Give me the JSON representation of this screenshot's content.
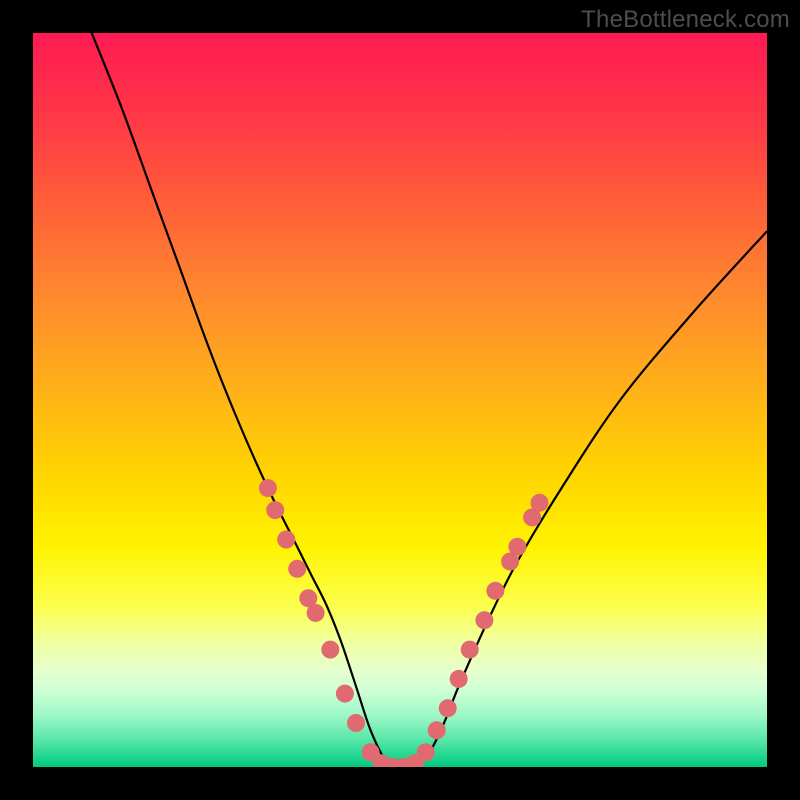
{
  "watermark": "TheBottleneck.com",
  "chart_data": {
    "type": "line",
    "title": "",
    "xlabel": "",
    "ylabel": "",
    "xlim": [
      0,
      100
    ],
    "ylim": [
      0,
      100
    ],
    "grid": false,
    "legend": false,
    "series": [
      {
        "name": "bottleneck-curve",
        "color": "#000000",
        "x": [
          8,
          12,
          16,
          20,
          24,
          28,
          32,
          36,
          38,
          40,
          42,
          44,
          46,
          48,
          50,
          52,
          54,
          56,
          58,
          62,
          66,
          72,
          80,
          90,
          100
        ],
        "y": [
          100,
          90,
          79,
          68,
          57,
          47,
          38,
          30,
          26,
          22,
          17,
          11,
          5,
          1,
          0,
          0.5,
          2,
          6,
          11,
          20,
          28,
          38,
          50,
          62,
          73
        ]
      }
    ],
    "markers": {
      "name": "scatter-dots",
      "color": "#e06a6f",
      "radius_px": 9,
      "points": [
        {
          "x": 32.0,
          "y": 38
        },
        {
          "x": 33.0,
          "y": 35
        },
        {
          "x": 34.5,
          "y": 31
        },
        {
          "x": 36.0,
          "y": 27
        },
        {
          "x": 37.5,
          "y": 23
        },
        {
          "x": 38.5,
          "y": 21
        },
        {
          "x": 40.5,
          "y": 16
        },
        {
          "x": 42.5,
          "y": 10
        },
        {
          "x": 44.0,
          "y": 6
        },
        {
          "x": 46.0,
          "y": 2
        },
        {
          "x": 47.5,
          "y": 0.5
        },
        {
          "x": 49.0,
          "y": 0
        },
        {
          "x": 50.5,
          "y": 0
        },
        {
          "x": 52.0,
          "y": 0.5
        },
        {
          "x": 53.5,
          "y": 2
        },
        {
          "x": 55.0,
          "y": 5
        },
        {
          "x": 56.5,
          "y": 8
        },
        {
          "x": 58.0,
          "y": 12
        },
        {
          "x": 59.5,
          "y": 16
        },
        {
          "x": 61.5,
          "y": 20
        },
        {
          "x": 63.0,
          "y": 24
        },
        {
          "x": 65.0,
          "y": 28
        },
        {
          "x": 66.0,
          "y": 30
        },
        {
          "x": 68.0,
          "y": 34
        },
        {
          "x": 69.0,
          "y": 36
        }
      ]
    }
  }
}
